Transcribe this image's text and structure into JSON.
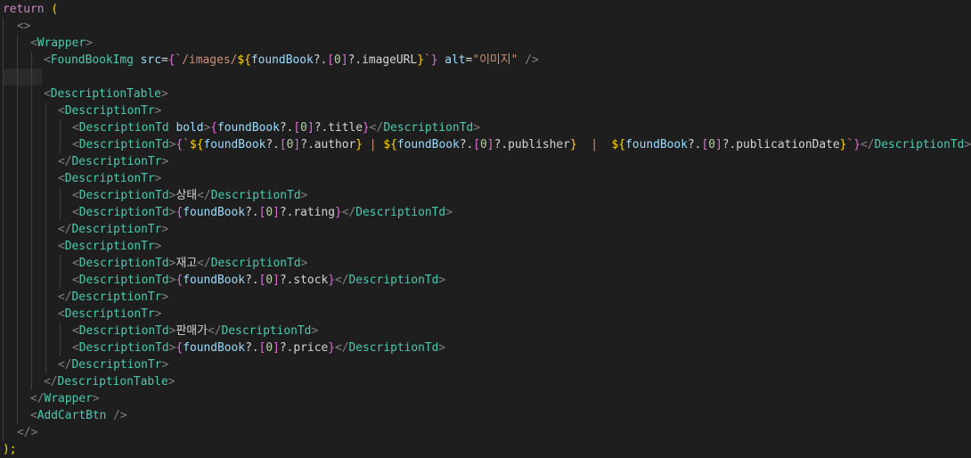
{
  "colors": {
    "background": "#1e1e1e",
    "keyword": "#c586c0",
    "component": "#4ec9b0",
    "angle_bracket": "#808080",
    "attribute": "#9cdcfe",
    "string": "#ce9178",
    "brace": "#ffd700"
  },
  "code": {
    "l1_return": "return",
    "l1_paren": " (",
    "l2_fragment_open": "<>",
    "l3_wrapper": "Wrapper",
    "l4_img": "FoundBookImg",
    "l4_src": "src",
    "l4_src_template_a": "`/images/",
    "l4_src_expr": "foundBook",
    "l4_src_opt": "?.",
    "l4_src_idx": "0",
    "l4_src_prop": "?.imageURL",
    "l4_src_template_b": "`",
    "l4_alt": "alt",
    "l4_alt_value": "\"이미지\"",
    "l4_selfclose": " />",
    "l6_table": "DescriptionTable",
    "tr": "DescriptionTr",
    "td": "DescriptionTd",
    "l8_bold": "bold",
    "l8_expr": "foundBook",
    "l8_prop": "?.title",
    "l9_author": "?.author",
    "l9_sep1": " | ",
    "l9_publisher": "?.publisher",
    "l9_sep2": "  |  ",
    "l9_pubdate": "?.publicationDate",
    "l12_label": "상태",
    "l13_prop": "?.rating",
    "l16_label": "재고",
    "l17_prop": "?.stock",
    "l20_label": "판매가",
    "l21_prop": "?.price",
    "l26_cart": "AddCartBtn",
    "l27_fragment_close": "</>",
    "l28_close": ");"
  }
}
